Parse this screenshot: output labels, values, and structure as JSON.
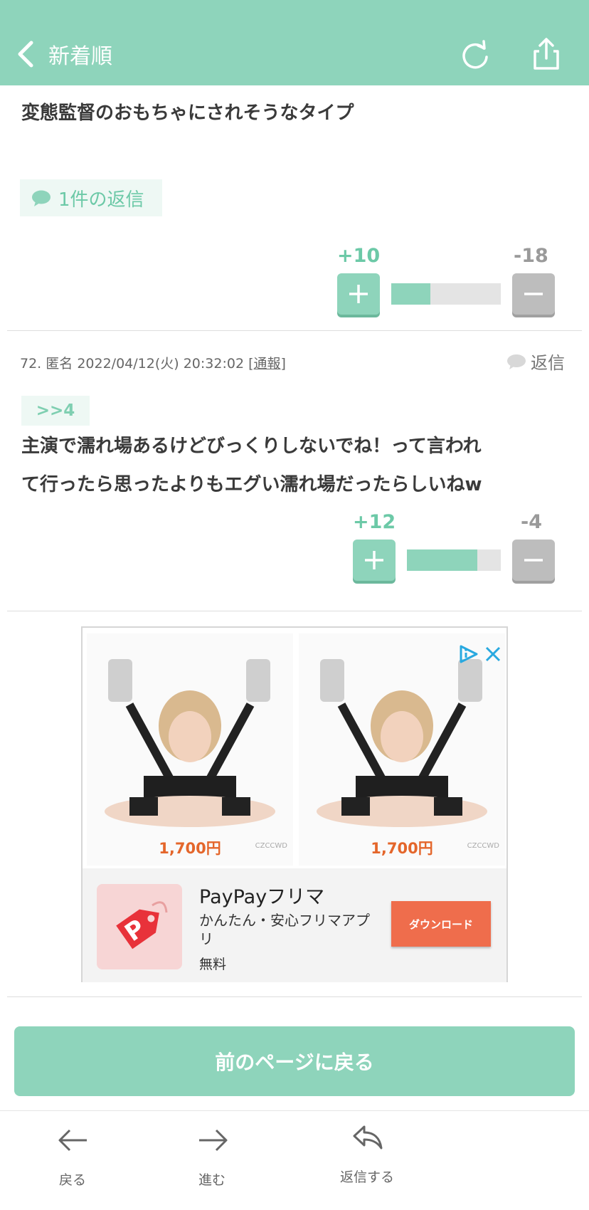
{
  "header": {
    "back_label": "新着順",
    "bg_color": "#8ed4bb"
  },
  "top_comment": {
    "text_line": "変態監督のおもちゃにされそうなタイプ",
    "reply_count_label": "1件の返信",
    "plus_count": "+10",
    "minus_count": "-18",
    "plus_ratio": 0.36
  },
  "comment": {
    "number": "72.",
    "author": "匿名",
    "datetime": "2022/04/12(火) 20:32:02",
    "report_open": "[",
    "report_label": "通報",
    "report_close": "]",
    "reply_label": "返信",
    "anchor": ">>4",
    "text_lines": [
      "主演で濡れ場あるけどびっくりしないでね！って言われ",
      "て行ったら思ったよりもエグい濡れ場だったらしいねw"
    ],
    "plus_count": "+12",
    "minus_count": "-4",
    "plus_ratio": 0.75
  },
  "ad": {
    "products": [
      {
        "price": "1,700円",
        "watermark": "CZCCWD"
      },
      {
        "price": "1,700円",
        "watermark": "CZCCWD"
      }
    ],
    "app_name": "PayPayフリマ",
    "app_desc": "かんたん・安心フリマアプリ",
    "app_price": "無料",
    "download_label": "ダウンロード"
  },
  "prev_page_label": "前のページに戻る",
  "bottom_nav": {
    "back_label": "戻る",
    "forward_label": "進む",
    "reply_label": "返信する"
  },
  "colors": {
    "accent": "#8ed4bb",
    "accent_text": "#6cc9a7",
    "vote_minus": "#bdbdbd",
    "download_btn": "#ef6d4c",
    "price": "#e4662b"
  }
}
